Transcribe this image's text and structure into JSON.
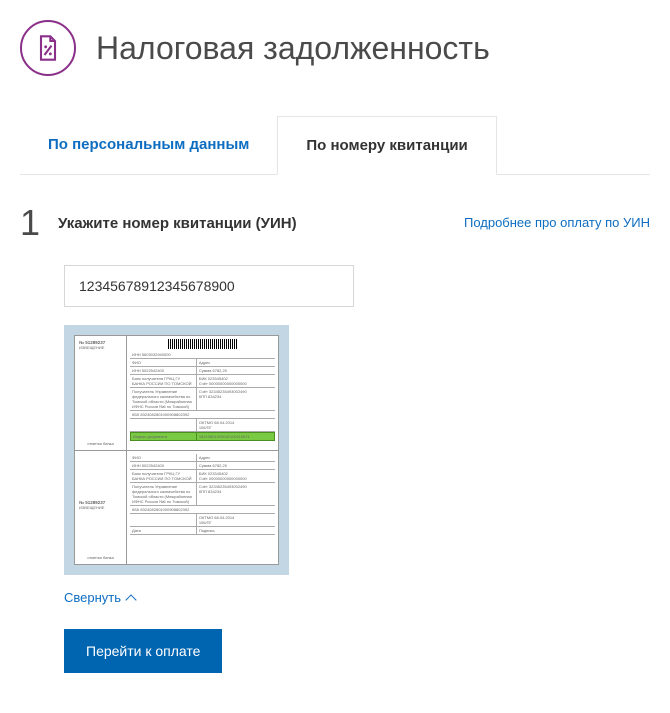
{
  "header": {
    "title": "Налоговая задолженность"
  },
  "tabs": {
    "personal": "По персональным данным",
    "receipt": "По номеру квитанции"
  },
  "step": {
    "number": "1",
    "title": "Укажите номер квитанции (УИН)",
    "help_link": "Подробнее про оплату по УИН"
  },
  "form": {
    "input_value": "12345678912345678900",
    "collapse_label": "Свернуть",
    "submit_label": "Перейти к оплате"
  },
  "receipt": {
    "num_label": "№ 51289237",
    "notice_label": "ИЗВЕЩЕНИЕ",
    "bank_marks": "отметки банка",
    "fio": "ФИО",
    "addr": "Адрес",
    "sum": "Сумма 6782,20",
    "date": "Дата",
    "sign": "Подпись",
    "index_doc": "Индекс документа",
    "highlight_value": "18210601020042100110671"
  }
}
